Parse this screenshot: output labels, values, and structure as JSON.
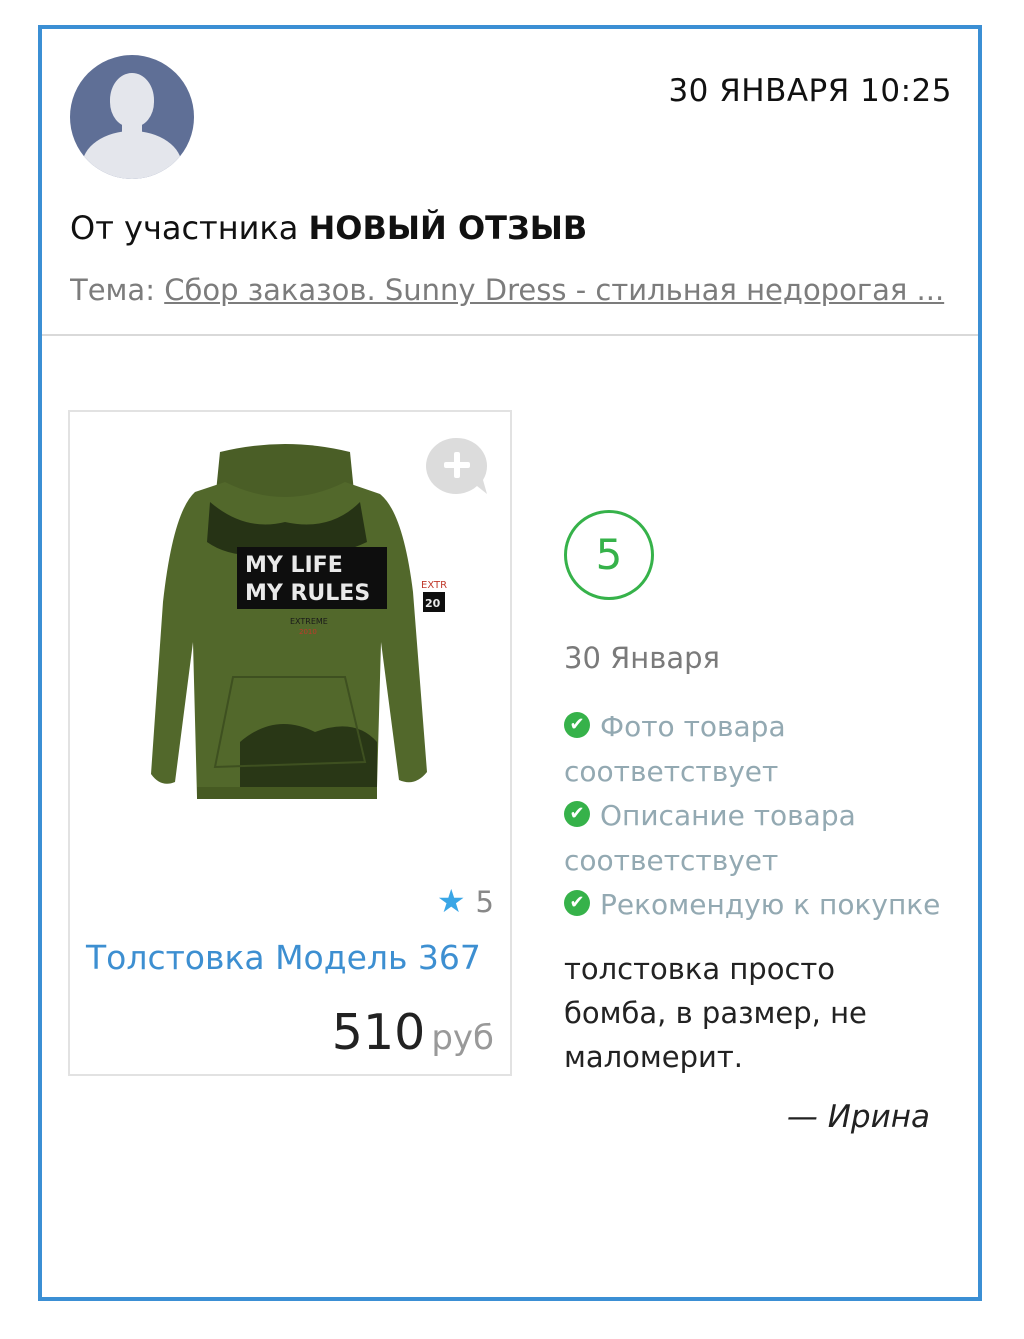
{
  "notification": {
    "date": "30 ЯНВАРЯ 10:25",
    "from_prefix": "От участника",
    "from_name": "НОВЫЙ ОТЗЫВ",
    "topic_label": "Тема:",
    "topic_link": "Сбор заказов. Sunny Dress - стильная недорогая ..."
  },
  "product": {
    "rating": "5",
    "name": "Толстовка Модель 367",
    "price": "510",
    "currency": "руб",
    "print_lines": [
      "MY LIFE",
      "MY RULES",
      "EXTREME",
      "2010",
      "EXTR",
      "20"
    ],
    "color": "#52682b"
  },
  "review": {
    "score": "5",
    "date": "30 Января",
    "checks": [
      "Фото товара соответствует",
      "Описание товара соответствует",
      "Рекомендую к покупке"
    ],
    "text": "толстовка просто бомба, в размер, не маломерит.",
    "author": "— Ирина"
  },
  "colors": {
    "frame": "#3b8fd4",
    "link": "#3d8fd1",
    "success": "#36b24a",
    "star": "#3aa6e6"
  },
  "icons": {
    "avatar": "user-silhouette-icon",
    "add": "plus-bubble-icon",
    "star": "star-icon",
    "check": "check-circle-icon"
  }
}
